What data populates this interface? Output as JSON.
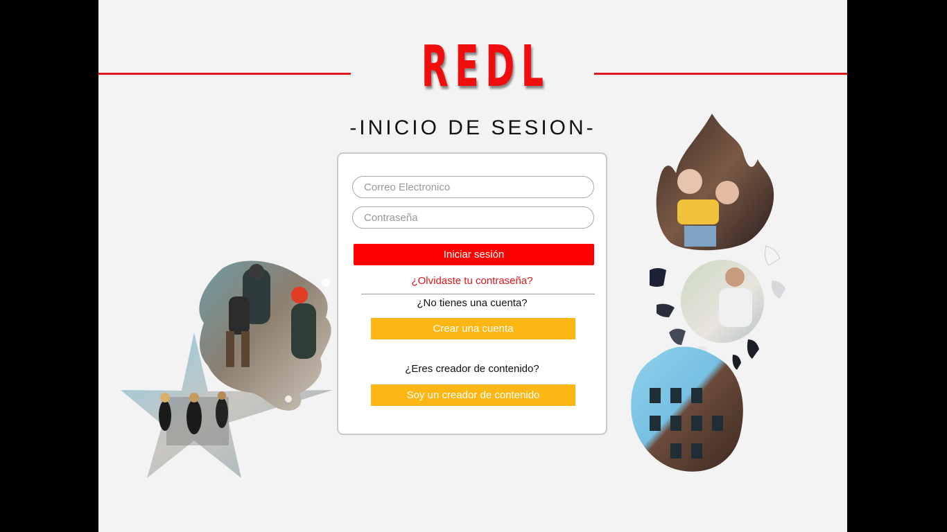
{
  "brand": {
    "name": "REDL",
    "accent": "#ff0000",
    "secondary": "#fdb714"
  },
  "page": {
    "title": "-INICIO DE SESION-"
  },
  "form": {
    "email_placeholder": "Correo Electronico",
    "password_placeholder": "Contraseña",
    "login_label": "Iniciar sesión",
    "forgot_label": "¿Olvidaste tu contraseña?",
    "no_account_text": "¿No tienes una cuenta?",
    "create_account_label": "Crear una cuenta",
    "creator_question": "¿Eres creador de contenido?",
    "creator_label": "Soy un creador de contenido"
  },
  "decorations": {
    "left": [
      "star-photo-friends",
      "splash-photo-hikers"
    ],
    "right": [
      "flame-photo-girls",
      "bubble-photo-man",
      "rounded-photo-building"
    ]
  }
}
